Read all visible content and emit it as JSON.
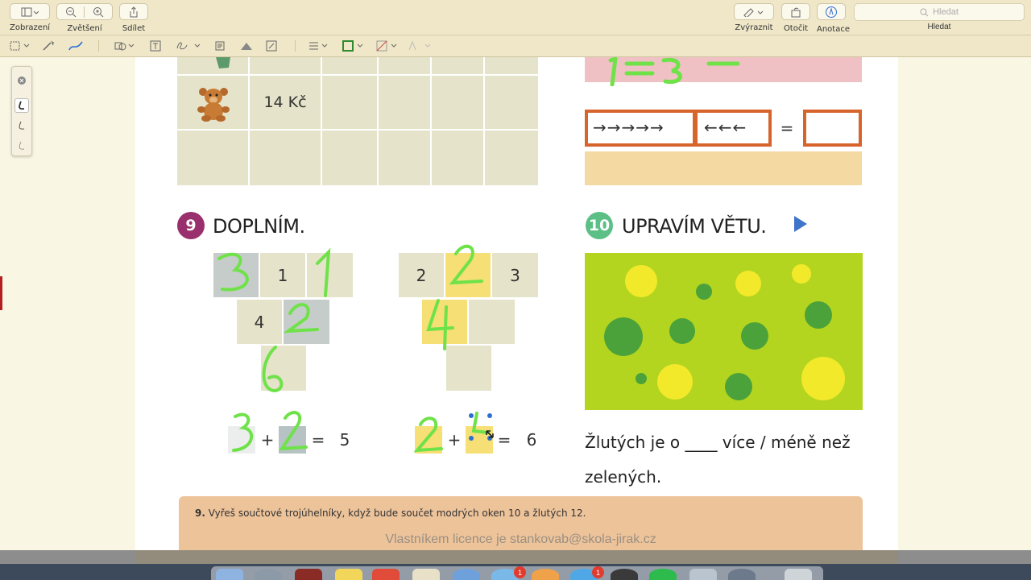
{
  "toolbar": {
    "view_label": "Zobrazení",
    "zoom_label": "Zvětšení",
    "share_label": "Sdílet",
    "highlight_label": "Zvýraznit",
    "rotate_label": "Otočit",
    "annotate_label": "Anotace",
    "search_placeholder": "Hledat",
    "search_label": "Hledat"
  },
  "page": {
    "price": "14 Kč",
    "arrows_right": "→→→→→",
    "arrows_left": "←←←",
    "equals": "=",
    "ex9": {
      "number": "9",
      "title": "DOPLNÍM."
    },
    "ex10": {
      "number": "10",
      "title": "UPRAVÍM VĚTU."
    },
    "tri1": {
      "top_middle": "1",
      "mid_left": "4",
      "eq_sign": "=",
      "eq_result": "5",
      "plus": "+"
    },
    "tri2": {
      "top_left": "2",
      "top_right": "3",
      "eq_sign": "=",
      "eq_result": "6",
      "plus": "+"
    },
    "sentence_line1": "Žlutých je o ____ více / méně než",
    "sentence_line2": "zelených.",
    "footnote_num": "9.",
    "footnote_text": "Vyřeš součtové trojúhelníky, když bude součet modrých oken 10 a žlutých 12.",
    "license": "Vlastníkem licence je stankovab@skola-jirak.cz"
  },
  "colors": {
    "toolbar_bg": "#efe7c8",
    "cell_bg": "#e5e3c9",
    "badge9": "#9a2f6d",
    "badge10": "#5bbf86",
    "handwriting": "#6fe24a",
    "green_panel": "#b4d51f",
    "orange_border": "#d7642a",
    "pink_band": "#f0c1c4",
    "peach_band": "#f5d9a2"
  },
  "dock_badges": [
    "1",
    "1"
  ]
}
